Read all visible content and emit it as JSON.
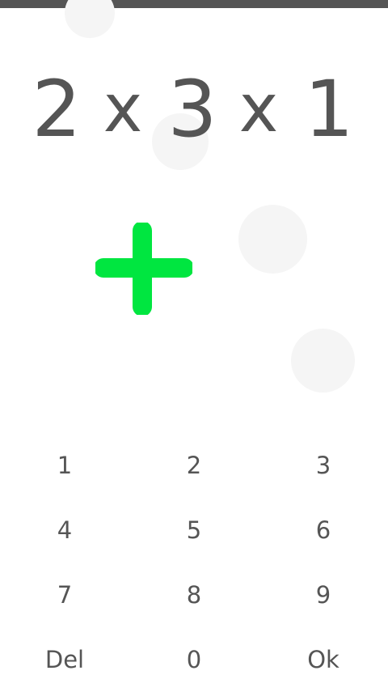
{
  "equation": {
    "tokens": [
      "2",
      "x",
      "3",
      "x",
      "1"
    ]
  },
  "operation": {
    "icon": "plus-icon",
    "color": "#00e640"
  },
  "keypad": {
    "keys": [
      "1",
      "2",
      "3",
      "4",
      "5",
      "6",
      "7",
      "8",
      "9",
      "Del",
      "0",
      "Ok"
    ]
  },
  "colors": {
    "text": "#555555",
    "status_bar": "#555555",
    "bubble": "#f5f5f5",
    "background": "#ffffff"
  }
}
